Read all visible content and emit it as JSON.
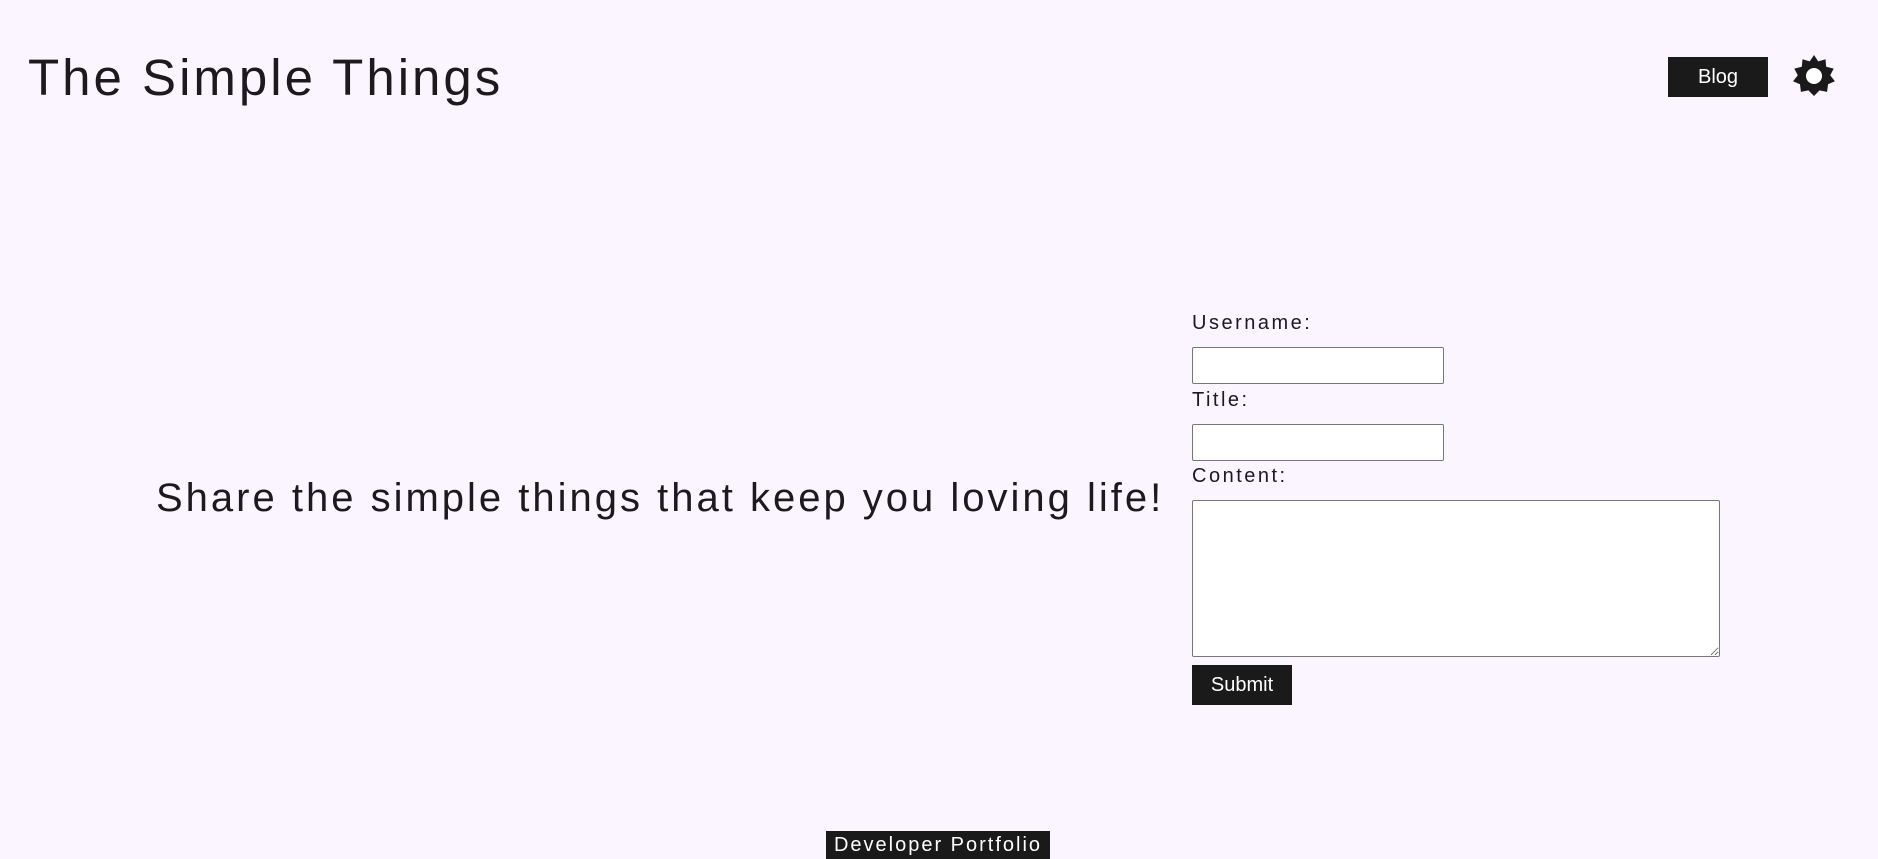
{
  "header": {
    "title": "The Simple Things",
    "blog_label": "Blog",
    "theme_toggle_icon": "sun-icon"
  },
  "main": {
    "tagline": "Share the simple things that keep you loving life!"
  },
  "form": {
    "username_label": "Username:",
    "username_value": "",
    "title_label": "Title:",
    "title_value": "",
    "content_label": "Content:",
    "content_value": "",
    "submit_label": "Submit"
  },
  "footer": {
    "link_label": "Developer Portfolio"
  },
  "colors": {
    "background": "#faf5fe",
    "text": "#1c1a1d",
    "button_background": "#1a1a1a",
    "button_text": "#ffffff"
  }
}
